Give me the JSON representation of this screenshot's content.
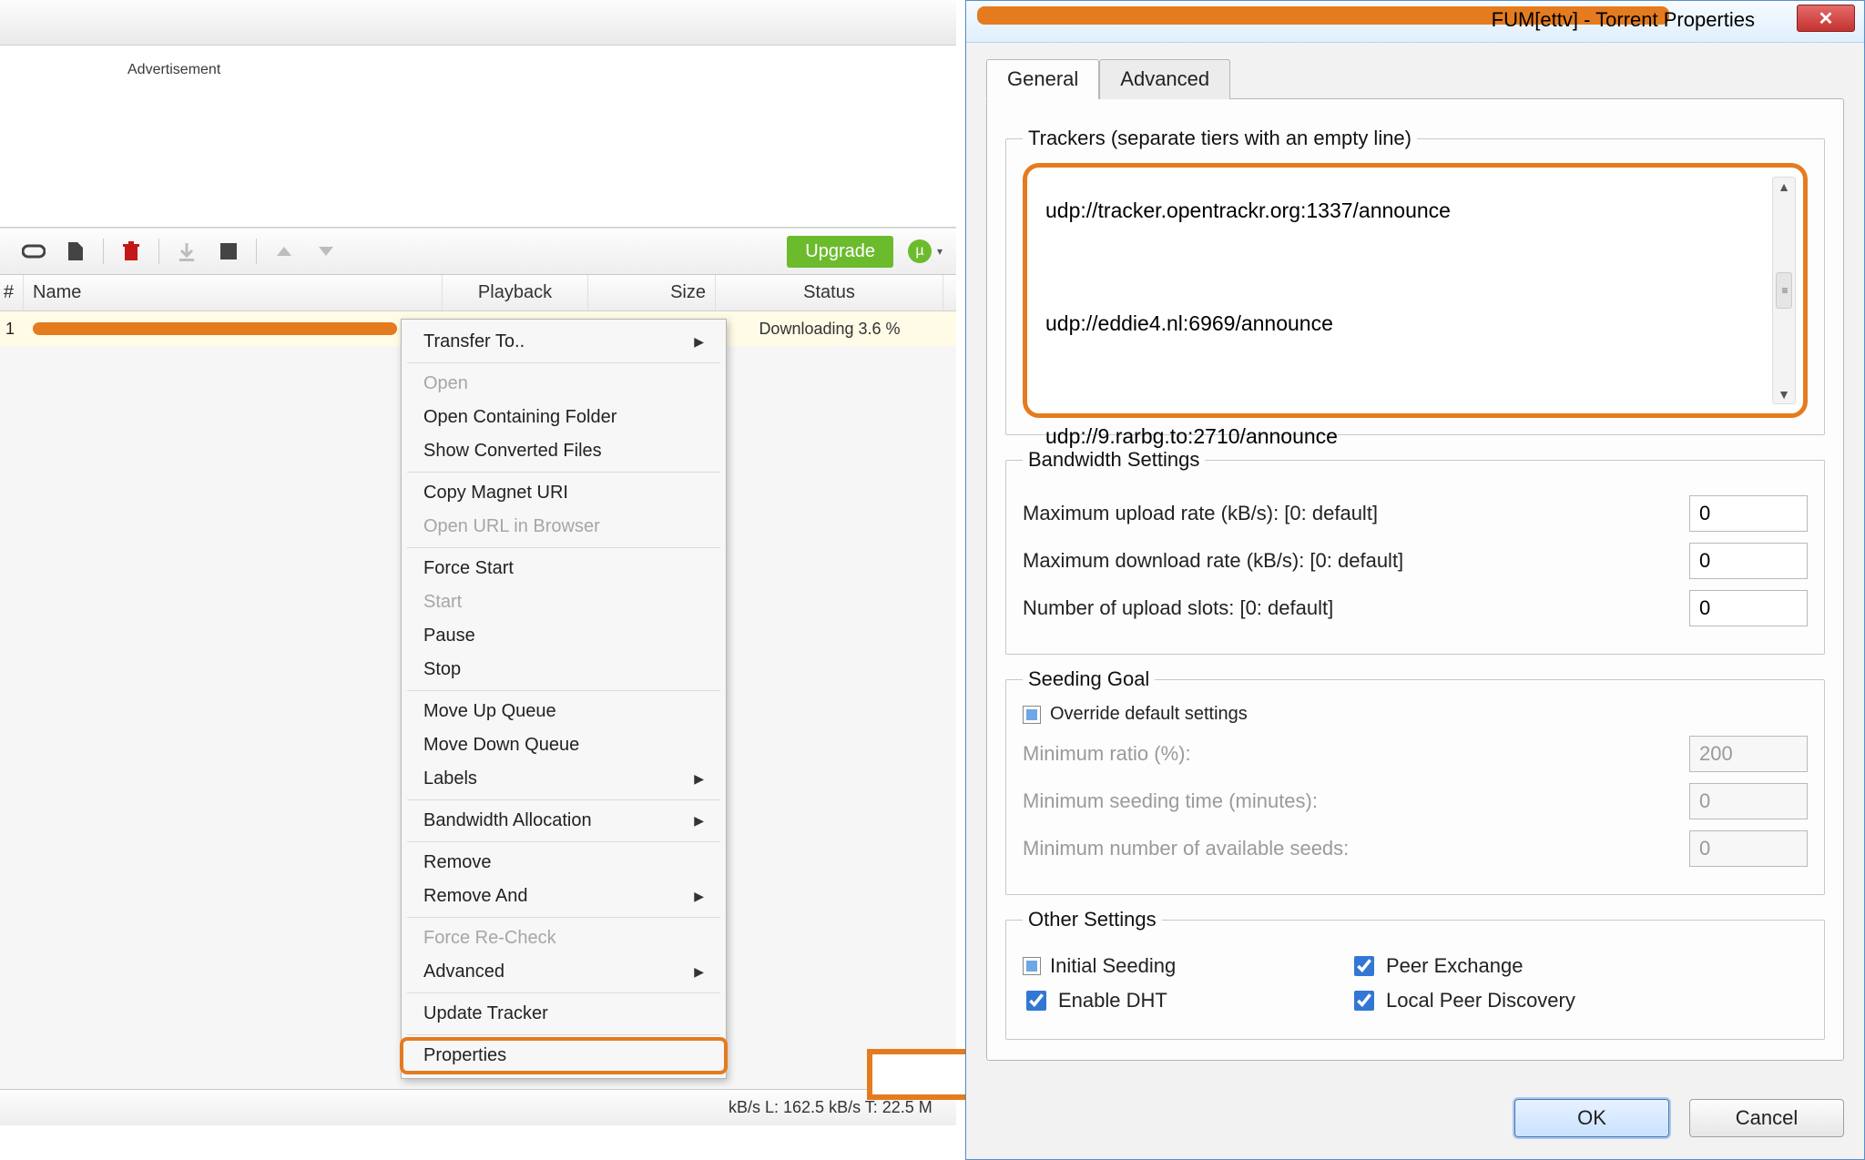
{
  "ad_label": "Advertisement",
  "toolbar": {
    "upgrade": "Upgrade"
  },
  "columns": {
    "num": "#",
    "name": "Name",
    "playback": "Playback",
    "size": "Size",
    "status": "Status"
  },
  "row": {
    "num": "1",
    "status": "Downloading 3.6 %"
  },
  "context_menu": {
    "transfer_to": "Transfer To..",
    "open": "Open",
    "open_containing": "Open Containing Folder",
    "show_converted": "Show Converted Files",
    "copy_magnet": "Copy Magnet URI",
    "open_url": "Open URL in Browser",
    "force_start": "Force Start",
    "start": "Start",
    "pause": "Pause",
    "stop": "Stop",
    "move_up": "Move Up Queue",
    "move_down": "Move Down Queue",
    "labels": "Labels",
    "bandwidth_alloc": "Bandwidth Allocation",
    "remove": "Remove",
    "remove_and": "Remove And",
    "force_recheck": "Force Re-Check",
    "advanced": "Advanced",
    "update_tracker": "Update Tracker",
    "properties": "Properties"
  },
  "statusbar": {
    "rates": "kB/s L: 162.5 kB/s  T: 22.5 M"
  },
  "dialog": {
    "title": "FUM[ettv] - Torrent Properties",
    "tabs": {
      "general": "General",
      "advanced": "Advanced"
    },
    "trackers_legend": "Trackers (separate tiers with an empty line)",
    "trackers_text": "udp://tracker.opentrackr.org:1337/announce\n\nudp://eddie4.nl:6969/announce\n\nudp://9.rarbg.to:2710/announce",
    "bandwidth": {
      "legend": "Bandwidth Settings",
      "max_up_label": "Maximum upload rate (kB/s): [0: default]",
      "max_up_value": "0",
      "max_down_label": "Maximum download rate (kB/s): [0: default]",
      "max_down_value": "0",
      "slots_label": "Number of upload slots: [0: default]",
      "slots_value": "0"
    },
    "seeding": {
      "legend": "Seeding Goal",
      "override": "Override default settings",
      "min_ratio_label": "Minimum ratio (%):",
      "min_ratio_value": "200",
      "min_time_label": "Minimum seeding time (minutes):",
      "min_time_value": "0",
      "min_seeds_label": "Minimum number of available seeds:",
      "min_seeds_value": "0"
    },
    "other": {
      "legend": "Other Settings",
      "initial_seeding": "Initial Seeding",
      "peer_exchange": "Peer Exchange",
      "enable_dht": "Enable DHT",
      "local_peer": "Local Peer Discovery"
    },
    "buttons": {
      "ok": "OK",
      "cancel": "Cancel"
    }
  }
}
